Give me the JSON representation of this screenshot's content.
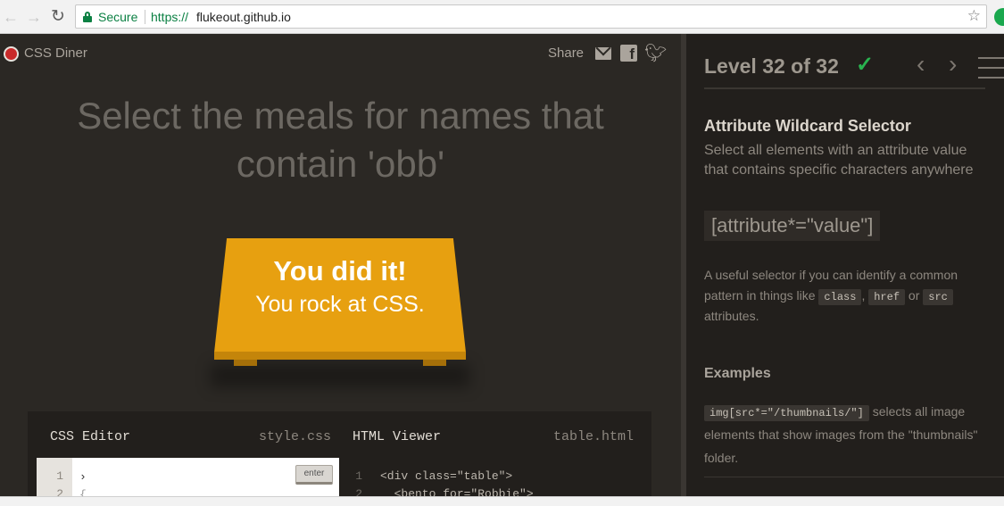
{
  "browser": {
    "secure_label": "Secure",
    "url_scheme": "https://",
    "url_host": "flukeout.github.io"
  },
  "game": {
    "brand": "CSS Diner",
    "share_label": "Share",
    "headline_line1": "Select the meals for names that",
    "headline_line2": "contain 'obb'",
    "win_line1": "You did it!",
    "win_line2": "You rock at CSS."
  },
  "editor": {
    "css_title": "CSS Editor",
    "css_file": "style.css",
    "html_title": "HTML Viewer",
    "html_file": "table.html",
    "css_lines": [
      "1",
      "2"
    ],
    "css_caret": "›",
    "css_brace": "{",
    "enter_label": "enter",
    "html_lines": [
      "1",
      "2"
    ],
    "html_code": [
      "<div class=\"table\">",
      "  <bento for=\"Robbie\">"
    ]
  },
  "sidebar": {
    "level_text": "Level 32 of 32",
    "selector_name": "Attribute Wildcard Selector",
    "selector_desc": "Select all elements with an attribute value that contains specific characters anywhere",
    "syntax": "[attribute*=\"value\"]",
    "hint_prefix": "A useful selector if you can identify a common pattern in things like",
    "hint_tags": [
      "class",
      "href",
      "src"
    ],
    "hint_or": "or",
    "hint_suffix": "attributes.",
    "examples_title": "Examples",
    "example1_code": "img[src*=\"/thumbnails/\"]",
    "example1_text": "selects all image elements that show images from the \"thumbnails\" folder."
  },
  "colors": {
    "accent_green": "#29b34f",
    "plate": "#e7a010",
    "background": "#2b2824"
  }
}
